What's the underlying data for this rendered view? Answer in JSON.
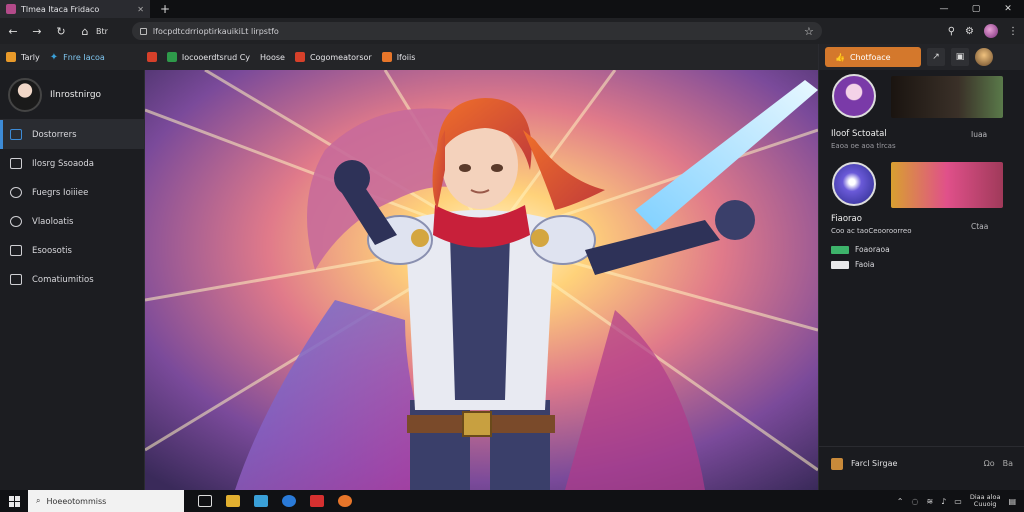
{
  "browser": {
    "tab_title": "Tlmea Itaca Fridaco",
    "window_controls": [
      "—",
      "▢",
      "✕"
    ],
    "home_label": "Btr",
    "url": "lfocpdtcdrrioptirkauikiLt lirpstfo",
    "icons": [
      "back-icon",
      "forward-icon",
      "reload-icon",
      "home-icon",
      "lock-icon",
      "star-icon",
      "extensions-icon",
      "settings-icon"
    ]
  },
  "bookmarks": [
    {
      "label": "Tarly",
      "color": "#e89a2a"
    },
    {
      "label": "Fnre Iacoa",
      "color": "#3aa0d8"
    }
  ],
  "page_tabs": [
    {
      "label": "",
      "color": "#d6402a"
    },
    {
      "label": "Iocooerdtsrud Cy",
      "color": "#2e9a4a"
    },
    {
      "label": "Hoose",
      "color": ""
    },
    {
      "label": "Cogomeatorsor",
      "color": "#d6402a"
    },
    {
      "label": "Ifoiis",
      "color": "#e8762a"
    }
  ],
  "sidebar": {
    "profile_name": "Ilnrostnirgo",
    "items": [
      {
        "label": "Dostorrers",
        "active": true,
        "icon": "dashboard-icon"
      },
      {
        "label": "Ilosrg Ssoaoda",
        "active": false,
        "icon": "library-icon"
      },
      {
        "label": "Fuegrs Ioiiiee",
        "active": false,
        "icon": "gallery-icon"
      },
      {
        "label": "Vlaoloatis",
        "active": false,
        "icon": "heart-icon"
      },
      {
        "label": "Esoosotis",
        "active": false,
        "icon": "bookmark-icon"
      },
      {
        "label": "Comatiumitios",
        "active": false,
        "icon": "community-icon"
      }
    ]
  },
  "right_panel": {
    "follow_label": "Chotfoace",
    "card1": {
      "title": "Iloof Sctoatal",
      "subtitle": "Eaoa oe aoa tlrcas",
      "count": "Iuaa"
    },
    "card2": {
      "title": "Fiaorao",
      "subtitle": "Coo ac taoCeooroorreo",
      "count": "Ctaa"
    },
    "rows": [
      {
        "label": "Foaoraoa",
        "accent": "#3db36a"
      },
      {
        "label": "Faoia",
        "accent": "#e8e8ea"
      }
    ],
    "footer": {
      "label": "Farcl Sirgae",
      "right_a": "Ωo",
      "right_b": "Ba"
    }
  },
  "taskbar": {
    "search_placeholder": "Hoeeotommiss",
    "clock_line1": "Diaa aloa",
    "clock_line2": "Cuuoig"
  }
}
